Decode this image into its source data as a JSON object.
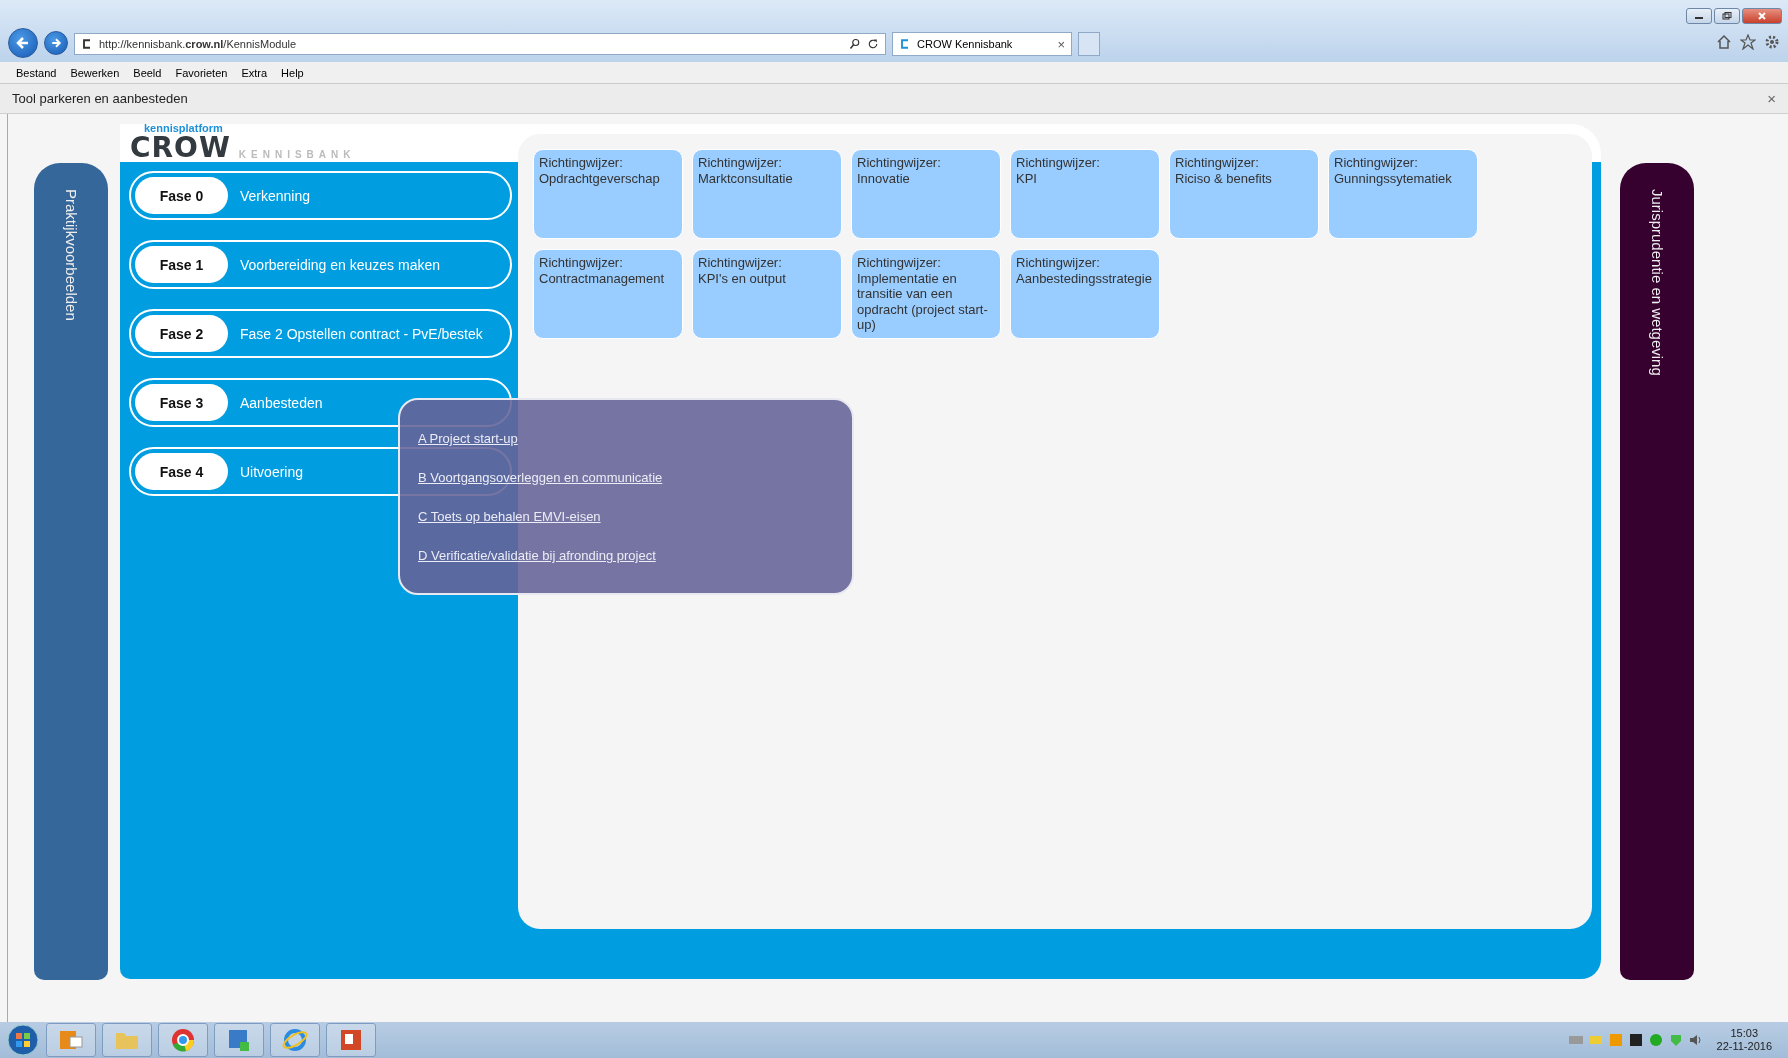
{
  "browser": {
    "address": "http://kennisbank.**crow.nl**/KennisModule",
    "tab": {
      "title": "CROW Kennisbank",
      "close": "×"
    },
    "menu": [
      "Bestand",
      "Bewerken",
      "Beeld",
      "Favorieten",
      "Extra",
      "Help"
    ]
  },
  "notification_bar": {
    "text": "Tool parkeren en aanbesteden",
    "close": "×"
  },
  "logo": {
    "top": "kennisplatform",
    "brand": "CROW",
    "subtitle": "KENNISBANK"
  },
  "left_tab": "Praktijkvoorbeelden",
  "right_tab": "Jurisprudentie en wetgeving",
  "phases": [
    {
      "label": "Fase 0",
      "title": "Verkenning"
    },
    {
      "label": "Fase 1",
      "title": "Voorbereiding en keuzes maken"
    },
    {
      "label": "Fase 2",
      "title": "Fase 2 Opstellen contract - PvE/bestek"
    },
    {
      "label": "Fase 3",
      "title": "Aanbesteden"
    },
    {
      "label": "Fase 4",
      "title": "Uitvoering"
    }
  ],
  "cards": [
    {
      "title": "Richtingwijzer:",
      "subject": "Opdrachtgeverschap"
    },
    {
      "title": "Richtingwijzer:",
      "subject": "Marktconsultatie"
    },
    {
      "title": "Richtingwijzer:",
      "subject": "Innovatie"
    },
    {
      "title": "Richtingwijzer:",
      "subject": "KPI"
    },
    {
      "title": "Richtingwijzer:",
      "subject": "Riciso & benefits"
    },
    {
      "title": "Richtingwijzer:",
      "subject": "Gunningssytematiek"
    },
    {
      "title": "Richtingwijzer:",
      "subject": "Contractmanagement"
    },
    {
      "title": "Richtingwijzer:",
      "subject": "KPI's en output"
    },
    {
      "title": "Richtingwijzer:",
      "subject": "Implementatie en transitie van een opdracht (project start-up)"
    },
    {
      "title": "Richtingwijzer:",
      "subject": "Aanbestedingsstrategie"
    }
  ],
  "popup": {
    "links": [
      "A Project start-up",
      "B Voortgangsoverleggen en communicatie",
      "C Toets op behalen EMVI-eisen",
      "D Verificatie/validatie bij afronding project"
    ]
  },
  "taskbar": {
    "time": "15:03",
    "date": "22-11-2016"
  }
}
